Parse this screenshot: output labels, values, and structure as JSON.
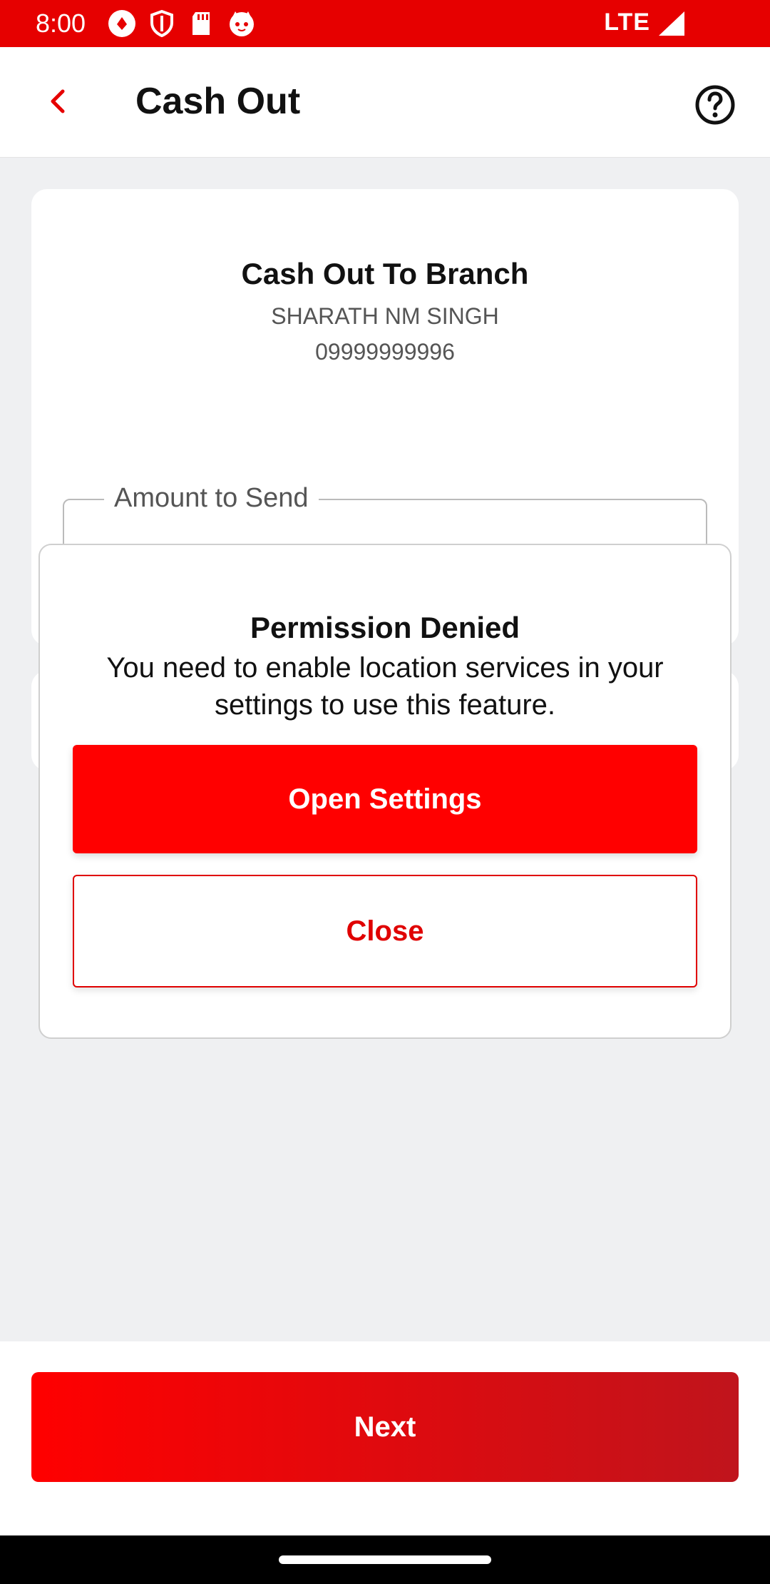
{
  "status_bar": {
    "time": "8:00",
    "network": "LTE",
    "icons": [
      "app-notification-icon",
      "shield-icon",
      "sd-card-icon",
      "cat-icon",
      "signal-icon"
    ]
  },
  "app_bar": {
    "title": "Cash Out",
    "back_icon": "chevron-left-icon",
    "help_icon": "help-circle-icon"
  },
  "card": {
    "title": "Cash Out To Branch",
    "name": "SHARATH NM SINGH",
    "phone": "09999999996",
    "amount_label": "Amount to Send"
  },
  "dialog": {
    "title": "Permission Denied",
    "message": "You need to enable location services in your settings to use this feature.",
    "primary_button": "Open Settings",
    "secondary_button": "Close"
  },
  "footer": {
    "next_button": "Next"
  },
  "colors": {
    "brand_red": "#e60000",
    "button_red": "#ff0000",
    "gradient_end": "#c0141c",
    "background": "#eff0f2"
  }
}
